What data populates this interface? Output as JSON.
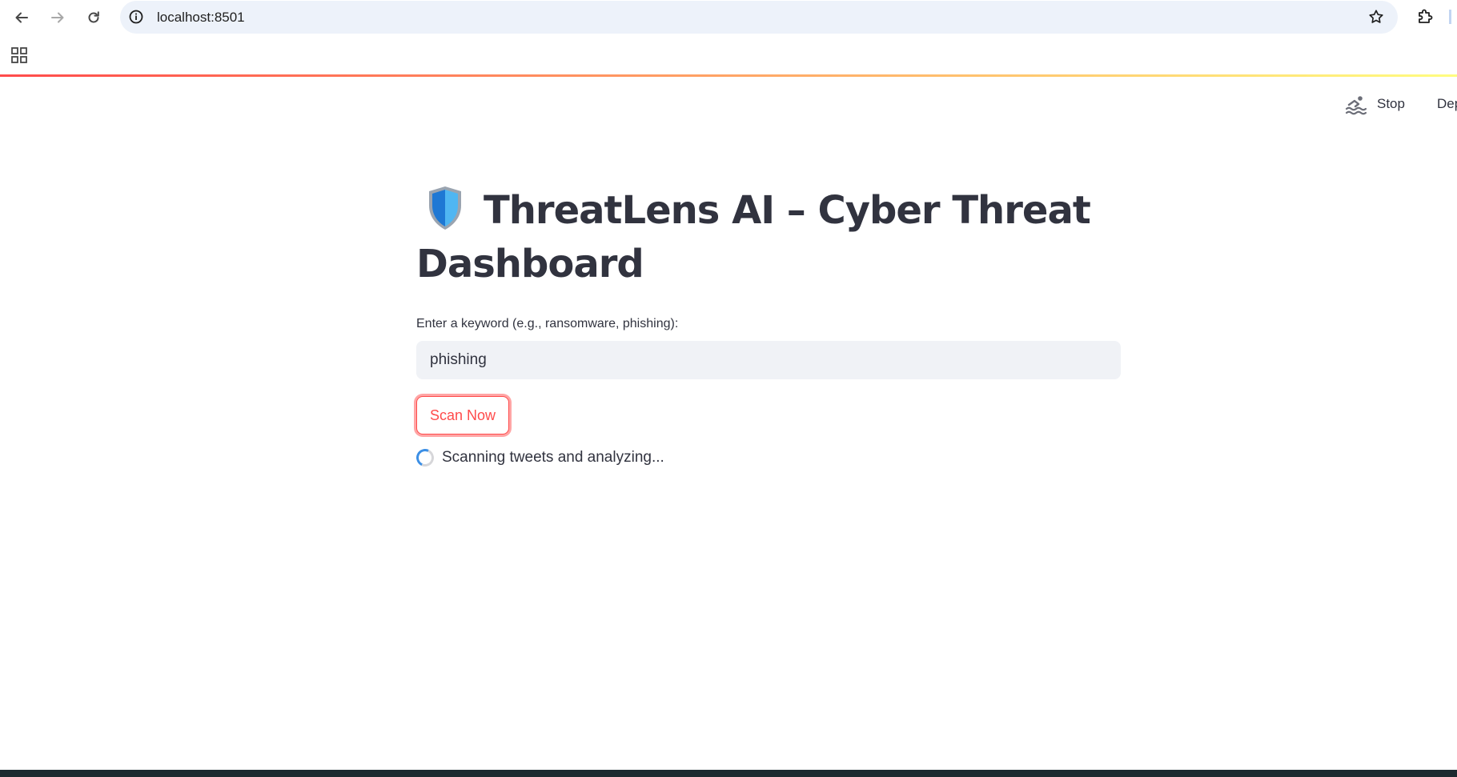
{
  "browser": {
    "url": "localhost:8501",
    "icons": {
      "back": "arrow-left-icon",
      "forward": "arrow-right-icon",
      "reload": "reload-icon",
      "site_info": "info-icon",
      "bookmark": "star-icon",
      "extensions": "puzzle-icon",
      "apps": "apps-grid-icon"
    }
  },
  "toolbar": {
    "running_icon": "swimmer-icon",
    "stop_label": "Stop",
    "deploy_label": "Dep"
  },
  "main": {
    "title": "ThreatLens AI – Cyber Threat Dashboard",
    "title_icon": "shield-icon",
    "input": {
      "label": "Enter a keyword (e.g., ransomware, phishing):",
      "value": "phishing"
    },
    "scan_button_label": "Scan Now",
    "status_text": "Scanning tweets and analyzing..."
  },
  "colors": {
    "accent": "#ff4b4b",
    "text": "#31333f",
    "input_bg": "#f0f2f6",
    "spinner": "#3c8fe5"
  }
}
